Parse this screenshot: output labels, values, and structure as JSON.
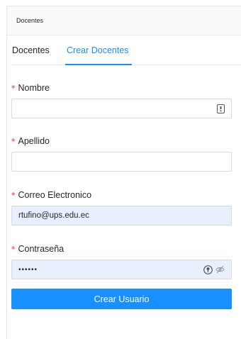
{
  "card": {
    "title": "Docentes"
  },
  "tabs": [
    {
      "label": "Docentes",
      "active": false
    },
    {
      "label": "Crear Docentes",
      "active": true
    }
  ],
  "form": {
    "required_mark": "*",
    "nombre": {
      "label": "Nombre",
      "value": "",
      "icon": "password-manager-icon"
    },
    "apellido": {
      "label": "Apellido",
      "value": ""
    },
    "correo": {
      "label": "Correo Electronico",
      "value": "rtufino@ups.edu.ec"
    },
    "contrasena": {
      "label": "Contraseña",
      "value": "••••••",
      "icons": [
        "key-icon",
        "eye-invisible-icon"
      ]
    },
    "submit_label": "Crear Usuario"
  },
  "colors": {
    "accent": "#1890ff",
    "required": "#f5222d",
    "autofill": "#e8f0fe"
  }
}
